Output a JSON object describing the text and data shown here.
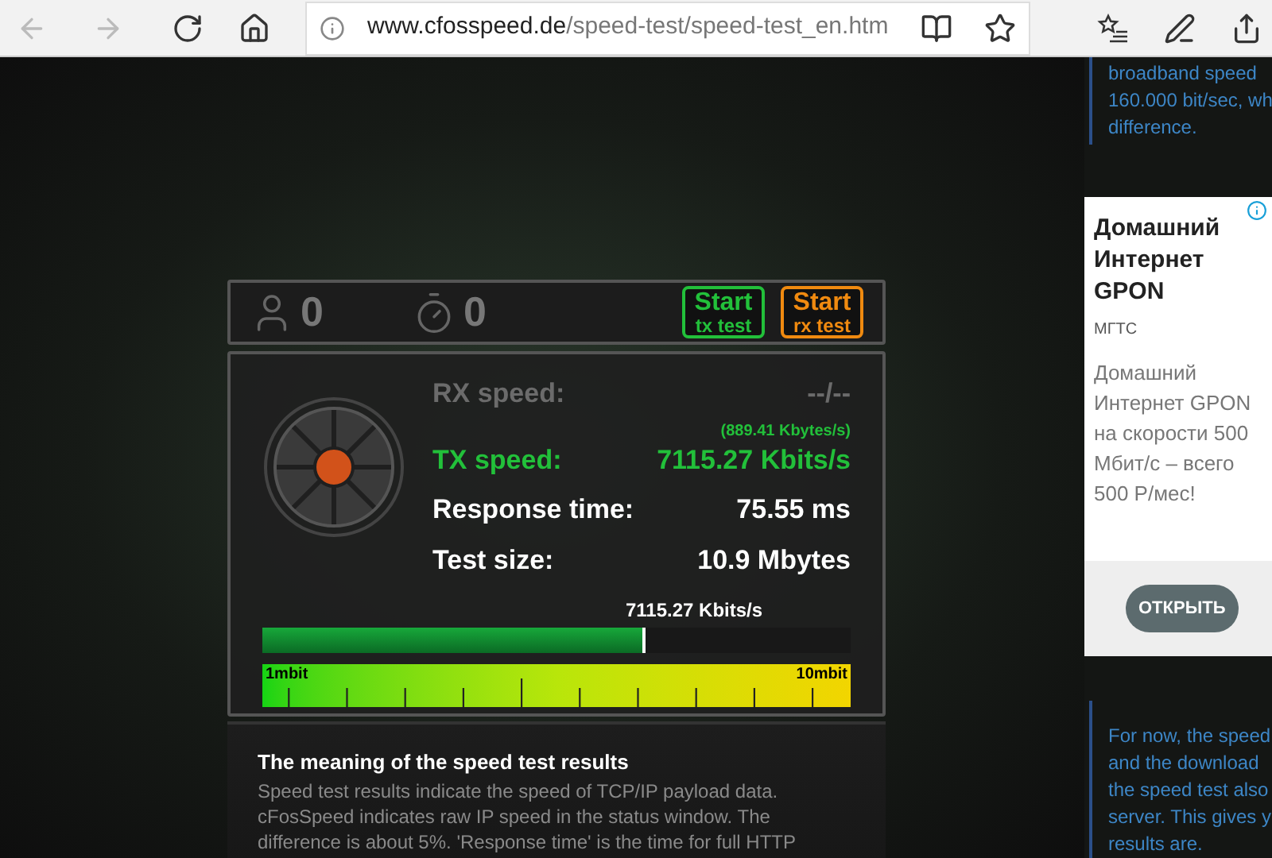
{
  "browser": {
    "url_domain": "www.cfosspeed.de",
    "url_path": "/speed-test/speed-test_en.htm"
  },
  "counters": [
    {
      "kind": "users",
      "value": "0"
    },
    {
      "kind": "timer",
      "value": "0"
    }
  ],
  "start_buttons": [
    {
      "title": "Start",
      "subtitle": "tx test",
      "color": "#22c03a"
    },
    {
      "title": "Start",
      "subtitle": "rx test",
      "color": "#f08a10"
    }
  ],
  "stats": [
    {
      "kind": "inactive",
      "label": "RX speed:",
      "value": "--/--"
    },
    {
      "kind": "active",
      "label": "TX speed:",
      "value": "7115.27 Kbits/s",
      "note": "(889.41 Kbytes/s)"
    },
    {
      "kind": "plain",
      "label": "Response time:",
      "value": "75.55 ms"
    },
    {
      "kind": "plain",
      "label": "Test size:",
      "value": "10.9 Mbytes"
    }
  ],
  "meter": {
    "reading": "7115.27 Kbits/s",
    "level": 0.65
  },
  "scale": {
    "min_label": "1mbit",
    "max_label": "10mbit"
  },
  "article": {
    "title": "The meaning of the speed test results",
    "lines": [
      "Speed test results indicate the speed of TCP/IP payload data.",
      "cFosSpeed indicates raw IP speed in the status window. The",
      "difference is about 5%. 'Response time' is the time for full HTTP"
    ]
  },
  "side_top_text": [
    "broadband speed",
    "160.000 bit/sec, wh",
    "difference."
  ],
  "ad": {
    "title": [
      "Домашний",
      "Интернет",
      "GPON"
    ],
    "advertiser": "МГТС",
    "body": [
      "Домашний",
      "Интернет GPON",
      "на скорости 500",
      "Мбит/с – всего",
      "500 Р/мес!"
    ],
    "button": "ОТКРЫТЬ"
  },
  "side_bottom_text": [
    "For now, the speed",
    "and the download",
    "the speed test also",
    "server. This gives y",
    "results are."
  ]
}
